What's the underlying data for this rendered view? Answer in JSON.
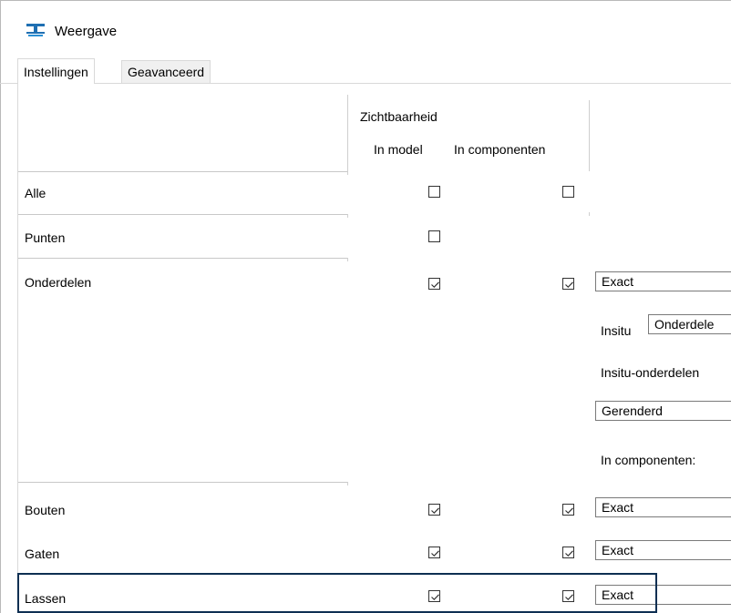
{
  "window": {
    "title": "Weergave",
    "icon": "display-settings-icon"
  },
  "tabs": [
    {
      "label": "Instellingen",
      "active": true
    },
    {
      "label": "Geavanceerd",
      "active": false
    }
  ],
  "table": {
    "group_header": "Zichtbaarheid",
    "col_model": "In model",
    "col_components": "In componenten",
    "rows": [
      {
        "label": "Alle",
        "in_model": false,
        "in_components": false,
        "mode": ""
      },
      {
        "label": "Punten",
        "in_model": false,
        "in_components": null,
        "mode": ""
      },
      {
        "label": "Onderdelen",
        "in_model": true,
        "in_components": true,
        "mode": "Exact"
      },
      {
        "label": "Bouten",
        "in_model": true,
        "in_components": true,
        "mode": "Exact"
      },
      {
        "label": "Gaten",
        "in_model": true,
        "in_components": true,
        "mode": "Exact"
      },
      {
        "label": "Lassen",
        "in_model": true,
        "in_components": true,
        "mode": "Exact"
      }
    ]
  },
  "onderdelen_details": {
    "insitu_label": "Insitu",
    "insitu_value": "Onderdele",
    "insitu_parts_label": "Insitu-onderdelen",
    "render_value": "Gerenderd",
    "in_components_label": "In componenten:"
  },
  "colors": {
    "highlight_border": "#0e2f52",
    "checkbox_border": "#333333"
  }
}
